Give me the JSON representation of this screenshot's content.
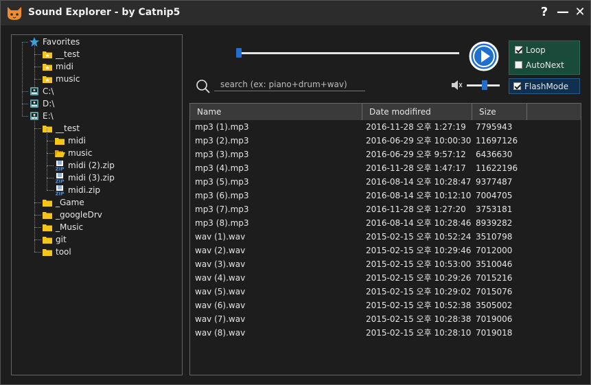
{
  "window": {
    "title": "Sound Explorer - by Catnip5",
    "help_label": "?",
    "minimize_label": "—",
    "close_label": "✕"
  },
  "tree": [
    {
      "label": "Favorites",
      "icon": "star-icon",
      "level": 0
    },
    {
      "label": "__test",
      "icon": "folder-star-icon",
      "level": 1
    },
    {
      "label": "midi",
      "icon": "folder-star-icon",
      "level": 1
    },
    {
      "label": "music",
      "icon": "folder-star-icon",
      "level": 1
    },
    {
      "label": "C:\\",
      "icon": "drive-icon",
      "level": 0
    },
    {
      "label": "D:\\",
      "icon": "drive-icon",
      "level": 0
    },
    {
      "label": "E:\\",
      "icon": "drive-icon",
      "level": 0
    },
    {
      "label": "__test",
      "icon": "folder-icon",
      "level": 1
    },
    {
      "label": "midi",
      "icon": "folder-icon",
      "level": 2
    },
    {
      "label": "music",
      "icon": "folder-open-icon",
      "level": 2
    },
    {
      "label": "midi (2).zip",
      "icon": "zip-icon",
      "level": 2
    },
    {
      "label": "midi (3).zip",
      "icon": "zip-icon",
      "level": 2
    },
    {
      "label": "midi.zip",
      "icon": "zip-icon",
      "level": 2
    },
    {
      "label": "_Game",
      "icon": "folder-icon",
      "level": 1
    },
    {
      "label": "_googleDrv",
      "icon": "folder-icon",
      "level": 1
    },
    {
      "label": "_Music",
      "icon": "folder-icon",
      "level": 1
    },
    {
      "label": "git",
      "icon": "folder-icon",
      "level": 1
    },
    {
      "label": "tool",
      "icon": "folder-icon",
      "level": 1
    }
  ],
  "player": {
    "seek_fraction": 0.0,
    "volume_fraction": 0.55,
    "options": {
      "loop": {
        "label": "Loop",
        "checked": true
      },
      "autonext": {
        "label": "AutoNext",
        "checked": false
      }
    },
    "flashmode": {
      "label": "FlashMode",
      "checked": true
    }
  },
  "search": {
    "placeholder": "search (ex: piano+drum+wav)",
    "value": ""
  },
  "list": {
    "columns": [
      "Name",
      "Date modifired",
      "Size"
    ],
    "rows": [
      {
        "name": "mp3 (1).mp3",
        "date": "2016-11-28 오후 1:27:19",
        "size": "7795943"
      },
      {
        "name": "mp3 (2).mp3",
        "date": "2016-06-29 오후 10:00:30",
        "size": "11697126"
      },
      {
        "name": "mp3 (3).mp3",
        "date": "2016-06-29 오후 9:57:12",
        "size": "6436630"
      },
      {
        "name": "mp3 (4).mp3",
        "date": "2016-11-28 오후 1:47:17",
        "size": "11622196"
      },
      {
        "name": "mp3 (5).mp3",
        "date": "2016-08-14 오후 10:28:47",
        "size": "9377487"
      },
      {
        "name": "mp3 (6).mp3",
        "date": "2016-08-14 오후 10:12:10",
        "size": "7004705"
      },
      {
        "name": "mp3 (7).mp3",
        "date": "2016-11-28 오후 1:27:20",
        "size": "3753181"
      },
      {
        "name": "mp3 (8).mp3",
        "date": "2016-08-14 오후 10:28:46",
        "size": "8939282"
      },
      {
        "name": "wav (1).wav",
        "date": "2015-02-15 오후 10:52:24",
        "size": "3510798"
      },
      {
        "name": "wav (2).wav",
        "date": "2015-02-15 오후 10:29:46",
        "size": "7012000"
      },
      {
        "name": "wav (3).wav",
        "date": "2015-02-15 오후 10:53:00",
        "size": "3510046"
      },
      {
        "name": "wav (4).wav",
        "date": "2015-02-15 오후 10:29:26",
        "size": "7015216"
      },
      {
        "name": "wav (5).wav",
        "date": "2015-02-15 오후 10:29:02",
        "size": "7015076"
      },
      {
        "name": "wav (6).wav",
        "date": "2015-02-15 오후 10:52:38",
        "size": "3505002"
      },
      {
        "name": "wav (7).wav",
        "date": "2015-02-15 오후 10:28:38",
        "size": "7019006"
      },
      {
        "name": "wav (8).wav",
        "date": "2015-02-15 오후 10:28:10",
        "size": "7019018"
      }
    ]
  },
  "colors": {
    "accent": "#1e6fd0",
    "options_bg": "#1a4a3a",
    "flash_bg": "#0f3050",
    "folder": "#f5c518"
  }
}
